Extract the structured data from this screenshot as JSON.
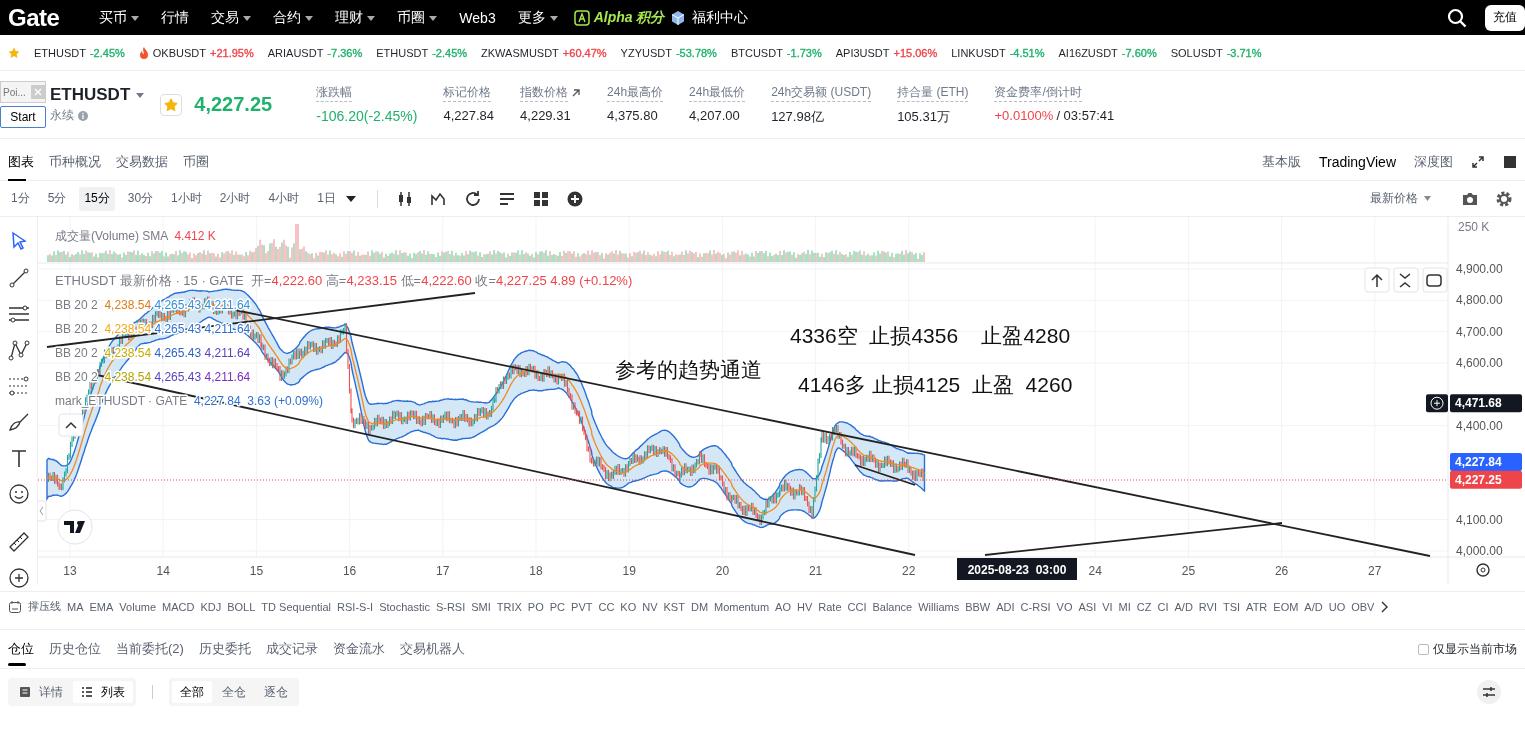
{
  "nav": {
    "logo": "Gate",
    "items": [
      {
        "label": "买币",
        "dropdown": true
      },
      {
        "label": "行情",
        "dropdown": false
      },
      {
        "label": "交易",
        "dropdown": true
      },
      {
        "label": "合约",
        "dropdown": true
      },
      {
        "label": "理财",
        "dropdown": true
      },
      {
        "label": "币圈",
        "dropdown": true
      },
      {
        "label": "Web3",
        "dropdown": false
      },
      {
        "label": "更多",
        "dropdown": true
      }
    ],
    "alpha": "Alpha 积分",
    "welfare": "福利中心",
    "deposit_button": "充值"
  },
  "ticker": [
    {
      "symbol": "ETHUSDT",
      "change": "-2.45%",
      "color": "#20b26c",
      "hot": false
    },
    {
      "symbol": "OKBUSDT",
      "change": "+21.95%",
      "color": "#ef454a",
      "hot": true
    },
    {
      "symbol": "ARIAUSDT",
      "change": "-7.36%",
      "color": "#20b26c",
      "hot": false
    },
    {
      "symbol": "ETHUSDT",
      "change": "-2.45%",
      "color": "#20b26c",
      "hot": false
    },
    {
      "symbol": "ZKWASMUSDT",
      "change": "+60.47%",
      "color": "#ef454a",
      "hot": false
    },
    {
      "symbol": "YZYUSDT",
      "change": "-53.78%",
      "color": "#20b26c",
      "hot": false
    },
    {
      "symbol": "BTCUSDT",
      "change": "-1.73%",
      "color": "#20b26c",
      "hot": false
    },
    {
      "symbol": "API3USDT",
      "change": "+15.06%",
      "color": "#ef454a",
      "hot": false
    },
    {
      "symbol": "LINKUSDT",
      "change": "-4.51%",
      "color": "#20b26c",
      "hot": false
    },
    {
      "symbol": "AI16ZUSDT",
      "change": "-7.60%",
      "color": "#20b26c",
      "hot": false
    },
    {
      "symbol": "SOLUSDT",
      "change": "-3.71%",
      "color": "#20b26c",
      "hot": false
    }
  ],
  "widget": {
    "text": "Poi...",
    "button": "Start"
  },
  "header": {
    "symbol": "ETHUSDT",
    "type": "永续",
    "favorite": true,
    "price": "4,227.25",
    "stats": [
      {
        "label": "涨跌幅",
        "value": "-106.20(-2.45%)",
        "color": "#20b26c"
      },
      {
        "label": "标记价格",
        "value": "4,227.84",
        "color": "#1e2329"
      },
      {
        "label": "指数价格",
        "value": "4,229.31",
        "color": "#1e2329",
        "link": true
      },
      {
        "label": "24h最高价",
        "value": "4,375.80",
        "color": "#1e2329"
      },
      {
        "label": "24h最低价",
        "value": "4,207.00",
        "color": "#1e2329"
      },
      {
        "label": "24h交易额 (USDT)",
        "value": "127.98亿",
        "color": "#1e2329"
      },
      {
        "label": "持合量 (ETH)",
        "value": "105.31万",
        "color": "#1e2329"
      },
      {
        "label": "资金费率/倒计时",
        "value": "+0.0100%",
        "color": "#ef454a",
        "suffix": "/ 03:57:41"
      }
    ]
  },
  "view_tabs": [
    {
      "label": "图表",
      "selected": true
    },
    {
      "label": "币种概况",
      "selected": false
    },
    {
      "label": "交易数据",
      "selected": false
    },
    {
      "label": "币圈",
      "selected": false
    }
  ],
  "chart_modes": [
    {
      "label": "基本版",
      "selected": false
    },
    {
      "label": "TradingView",
      "selected": true
    },
    {
      "label": "深度图",
      "selected": false
    }
  ],
  "intervals": [
    {
      "label": "1分",
      "selected": false
    },
    {
      "label": "5分",
      "selected": false
    },
    {
      "label": "15分",
      "selected": true
    },
    {
      "label": "30分",
      "selected": false
    },
    {
      "label": "1小时",
      "selected": false
    },
    {
      "label": "2小时",
      "selected": false
    },
    {
      "label": "4小时",
      "selected": false
    },
    {
      "label": "1日",
      "selected": false,
      "dropdown": true
    }
  ],
  "price_source": "最新价格",
  "chart": {
    "volume_legend": {
      "title": "成交量(Volume) SMA",
      "value": "4.412 K"
    },
    "volume_axis": "250 K",
    "symbol_legend": {
      "title": "ETHUSDT 最新价格 · 15 · GATE",
      "ohlc": [
        {
          "label": "开=",
          "value": "4,222.60"
        },
        {
          "label": "高=",
          "value": "4,233.15"
        },
        {
          "label": "低=",
          "value": "4,222.60"
        },
        {
          "label": "收=",
          "value": "4,227.25"
        }
      ],
      "change": "4.89 (+0.12%)"
    },
    "bb_rows": [
      {
        "name": "BB 20 2",
        "values": [
          {
            "text": "4,238.54",
            "color": "#e07b1a"
          },
          {
            "text": "4,265.43",
            "color": "#2f8fd8"
          },
          {
            "text": "4,211.64",
            "color": "#2f8fd8"
          }
        ]
      },
      {
        "name": "BB 20 2",
        "values": [
          {
            "text": "4,238.54",
            "color": "#f0a818"
          },
          {
            "text": "4,265.43",
            "color": "#2e6fd0"
          },
          {
            "text": "4,211.64",
            "color": "#2e6fd0"
          }
        ]
      },
      {
        "name": "BB 20 2",
        "values": [
          {
            "text": "4,238.54",
            "color": "#c2ae00"
          },
          {
            "text": "4,265.43",
            "color": "#2e5fc8"
          },
          {
            "text": "4,211.64",
            "color": "#5a3fc0"
          }
        ]
      },
      {
        "name": "BB 20 2",
        "values": [
          {
            "text": "4,238.54",
            "color": "#b0a600"
          },
          {
            "text": "4,265.43",
            "color": "#5a3fc0"
          },
          {
            "text": "4,211.64",
            "color": "#7a30c0"
          }
        ]
      }
    ],
    "mark_legend": {
      "title": "mark_ETHUSDT · GATE",
      "value": "4,227.84",
      "change": "3.63 (+0.09%)"
    },
    "annotations": [
      "4336空  止损4356    止盈4280",
      "参考的趋势通道",
      "4146多 止损4125  止盈  4260"
    ],
    "price_axis": [
      "4,900.00",
      "4,800.00",
      "4,700.00",
      "4,600.00",
      "4,400.00",
      "4,100.00",
      "4,000.00"
    ],
    "price_marks": [
      {
        "label": "4,471.68",
        "kind": "crosshair"
      },
      {
        "label": "4,227.84",
        "kind": "mark"
      },
      {
        "label": "4,227.25",
        "kind": "last"
      }
    ],
    "x_axis": [
      "13",
      "14",
      "15",
      "16",
      "17",
      "18",
      "19",
      "20",
      "21",
      "22",
      "24",
      "25",
      "26",
      "27"
    ],
    "crosshair_time": "2025-08-23  03:00"
  },
  "indicators": [
    "撑压线",
    "MA",
    "EMA",
    "Volume",
    "MACD",
    "KDJ",
    "BOLL",
    "TD Sequential",
    "RSI-S-I",
    "Stochastic",
    "S-RSI",
    "SMI",
    "TRIX",
    "PO",
    "PC",
    "PVT",
    "CC",
    "KO",
    "NV",
    "KST",
    "DM",
    "Momentum",
    "AO",
    "HV",
    "Rate",
    "CCI",
    "Balance",
    "Williams",
    "BBW",
    "ADI",
    "C-RSI",
    "VO",
    "ASI",
    "VI",
    "MI",
    "CZ",
    "CI",
    "A/D",
    "RVI",
    "TSI",
    "ATR",
    "EOM",
    "A/D",
    "UO",
    "OBV"
  ],
  "order_tabs": [
    {
      "label": "仓位",
      "selected": true
    },
    {
      "label": "历史仓位",
      "selected": false
    },
    {
      "label": "当前委托(2)",
      "selected": false
    },
    {
      "label": "历史委托",
      "selected": false
    },
    {
      "label": "成交记录",
      "selected": false
    },
    {
      "label": "资金流水",
      "selected": false
    },
    {
      "label": "交易机器人",
      "selected": false
    }
  ],
  "current_market_only": {
    "label": "仅显示当前市场",
    "checked": false
  },
  "view_toggle": [
    {
      "label": "详情",
      "kind": "detail",
      "selected": false
    },
    {
      "label": "列表",
      "kind": "list",
      "selected": true
    }
  ],
  "margin_filter": [
    {
      "label": "全部",
      "selected": true
    },
    {
      "label": "全仓",
      "selected": false
    },
    {
      "label": "逐仓",
      "selected": false
    }
  ]
}
